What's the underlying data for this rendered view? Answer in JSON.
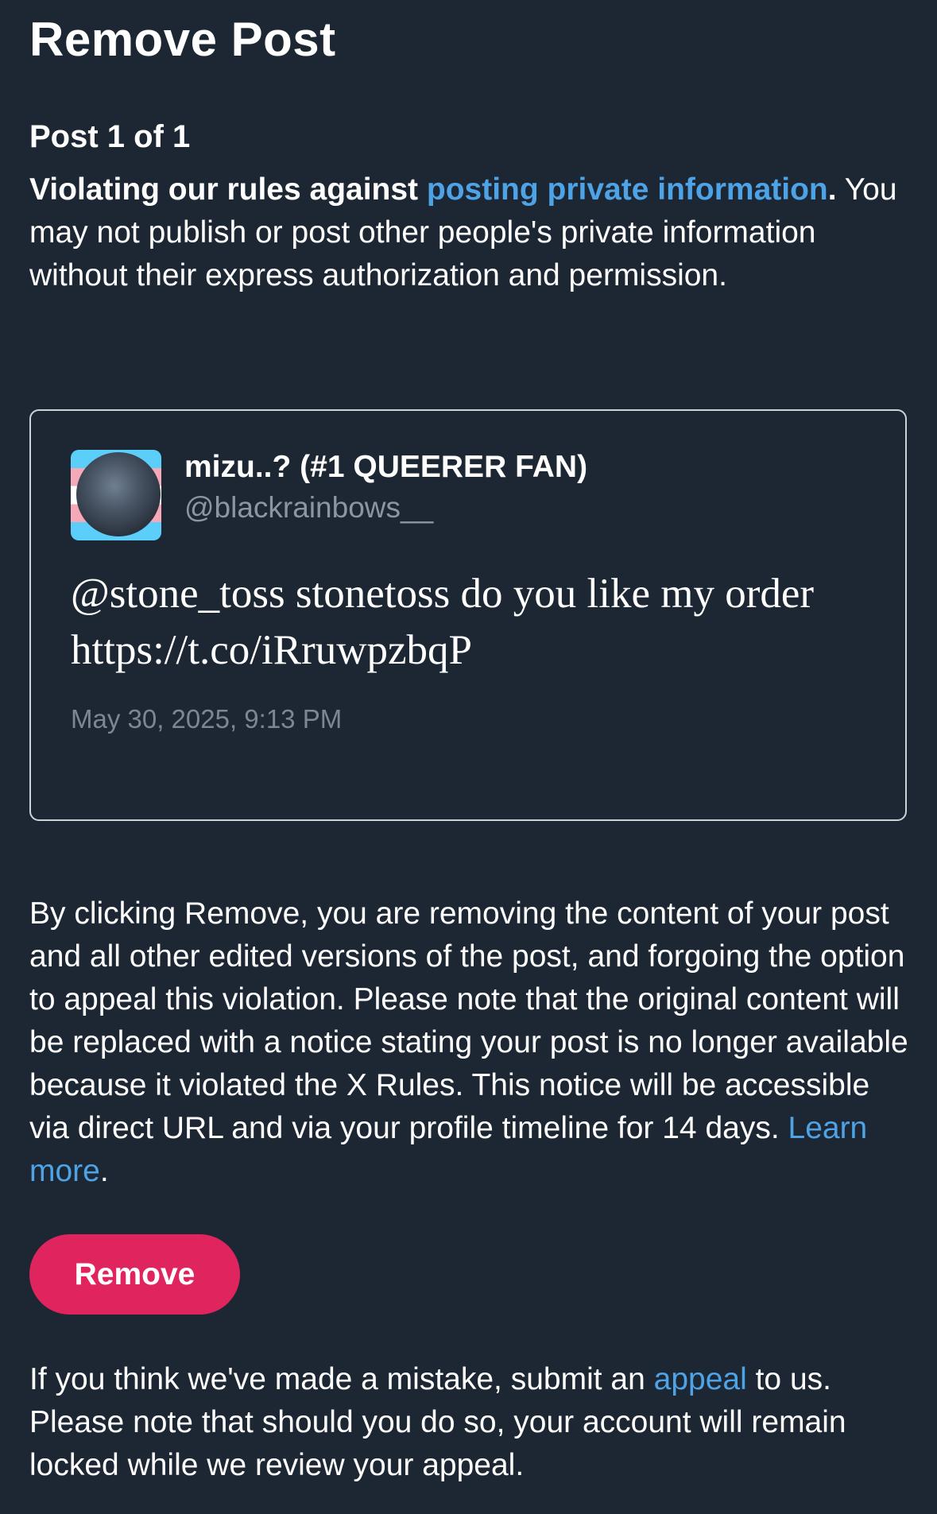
{
  "header": {
    "title": "Remove Post"
  },
  "violation": {
    "post_count": "Post 1 of 1",
    "rule_lead": "Violating our rules against ",
    "rule_link": "posting private information",
    "rule_period": ".",
    "rule_description": "You may not publish or post other people's private information without their express authorization and permission."
  },
  "post": {
    "author_name": "mizu..? (#1 QUEERER FAN)",
    "author_handle": "@blackrainbows__",
    "text": "@stone_toss stonetoss do you like my order https://t.co/iRruwpzbqP",
    "timestamp": "May 30, 2025, 9:13 PM",
    "avatar_icon": "user-avatar"
  },
  "notice": {
    "text": "By clicking Remove, you are removing the content of your post and all other edited versions of the post, and forgoing the option to appeal this violation. Please note that the original content will be replaced with a notice stating your post is no longer available because it violated the X Rules. This notice will be accessible via direct URL and via your profile timeline for 14 days. ",
    "learn_more": "Learn more",
    "period": "."
  },
  "actions": {
    "remove_label": "Remove"
  },
  "appeal": {
    "before": "If you think we've made a mistake, submit an ",
    "link": "appeal",
    "after": " to us. Please note that should you do so, your account will remain locked while we review your appeal."
  },
  "colors": {
    "background": "#1d2733",
    "link": "#4da3e6",
    "remove_button": "#e0245e",
    "secondary_text": "#8c96a1"
  }
}
